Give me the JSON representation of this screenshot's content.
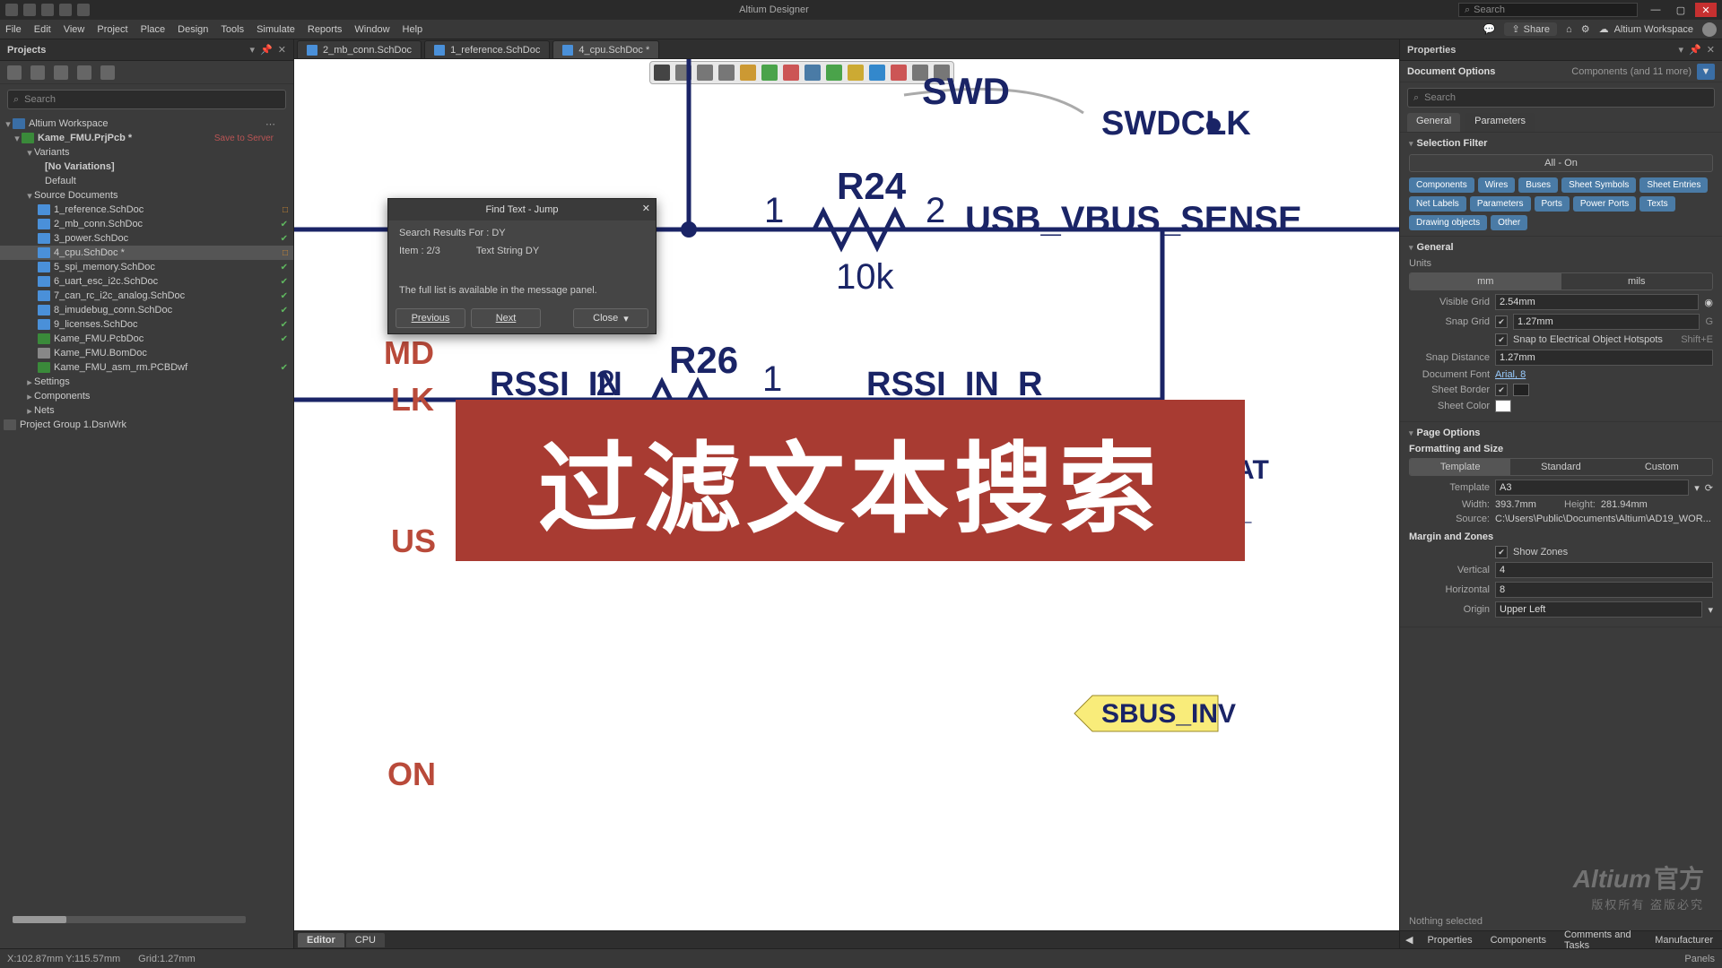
{
  "app_title": "Altium Designer",
  "global_search_placeholder": "Search",
  "menu": [
    "File",
    "Edit",
    "View",
    "Project",
    "Place",
    "Design",
    "Tools",
    "Simulate",
    "Reports",
    "Window",
    "Help"
  ],
  "share_label": "Share",
  "workspace_label": "Altium Workspace",
  "projects_panel_title": "Projects",
  "project_search_placeholder": "Search",
  "tree": {
    "ws": "Altium Workspace",
    "project": "Kame_FMU.PrjPcb *",
    "save_to_server": "Save to Server",
    "variants": "Variants",
    "no_var": "[No Variations]",
    "default": "Default",
    "src": "Source Documents",
    "docs": [
      {
        "n": "1_reference.SchDoc",
        "i": "sch",
        "mark": "mod"
      },
      {
        "n": "2_mb_conn.SchDoc",
        "i": "sch",
        "mark": "ok"
      },
      {
        "n": "3_power.SchDoc",
        "i": "sch",
        "mark": "ok"
      },
      {
        "n": "4_cpu.SchDoc *",
        "i": "sch",
        "mark": "mod",
        "sel": true
      },
      {
        "n": "5_spi_memory.SchDoc",
        "i": "sch",
        "mark": "ok"
      },
      {
        "n": "6_uart_esc_i2c.SchDoc",
        "i": "sch",
        "mark": "ok"
      },
      {
        "n": "7_can_rc_i2c_analog.SchDoc",
        "i": "sch",
        "mark": "ok"
      },
      {
        "n": "8_imudebug_conn.SchDoc",
        "i": "sch",
        "mark": "ok"
      },
      {
        "n": "9_licenses.SchDoc",
        "i": "sch",
        "mark": "ok"
      }
    ],
    "pcb": "Kame_FMU.PcbDoc",
    "bom": "Kame_FMU.BomDoc",
    "pcbdwf": "Kame_FMU_asm_rm.PCBDwf",
    "settings": "Settings",
    "components": "Components",
    "nets": "Nets",
    "group": "Project Group 1.DsnWrk"
  },
  "doc_tabs": [
    {
      "n": "2_mb_conn.SchDoc"
    },
    {
      "n": "1_reference.SchDoc"
    },
    {
      "n": "4_cpu.SchDoc *",
      "active": true
    }
  ],
  "canvas": {
    "swd": "SWD",
    "swdclk": "SWDCLK",
    "r24": "R24",
    "r24v": "10k",
    "pin1": "1",
    "pin2": "2",
    "usb": "USB_VBUS_SENSE",
    "r26": "R26",
    "rssi_in": "RSSI_IN",
    "rssi_in_r": "RSSI_IN_R",
    "heat": "MU_HEAT",
    "rc": "MU_RC_",
    "sbus": "SBUS_INV",
    "md": "MD",
    "lk": "LK",
    "us": "US",
    "on": "ON",
    "overlay": "过滤文本搜索"
  },
  "dialog": {
    "title": "Find Text - Jump",
    "results_for": "Search Results For : DY",
    "item": "Item : 2/3",
    "type": "Text String DY",
    "msg": "The full list is available in the message panel.",
    "prev": "Previous",
    "next": "Next",
    "close": "Close"
  },
  "editor_tabs": [
    "Editor",
    "CPU"
  ],
  "properties": {
    "title": "Properties",
    "doc_options": "Document Options",
    "more": "Components (and 11 more)",
    "search_placeholder": "Search",
    "tabs": [
      "General",
      "Parameters"
    ],
    "selection_filter": "Selection Filter",
    "all_on": "All - On",
    "chips": [
      "Components",
      "Wires",
      "Buses",
      "Sheet Symbols",
      "Sheet Entries",
      "Net Labels",
      "Parameters",
      "Ports",
      "Power Ports",
      "Texts",
      "Drawing objects",
      "Other"
    ],
    "general": "General",
    "units": "Units",
    "mm": "mm",
    "mils": "mils",
    "visible_grid": "Visible Grid",
    "visible_grid_v": "2.54mm",
    "snap_grid": "Snap Grid",
    "snap_grid_v": "1.27mm",
    "snap_g_key": "G",
    "snap_elec": "Snap to Electrical Object Hotspots",
    "snap_elec_key": "Shift+E",
    "snap_dist": "Snap Distance",
    "snap_dist_v": "1.27mm",
    "doc_font": "Document Font",
    "doc_font_v": "Arial, 8",
    "sheet_border": "Sheet Border",
    "sheet_color": "Sheet Color",
    "page_options": "Page Options",
    "fmt_size": "Formatting and Size",
    "template": "Template",
    "std": "Standard",
    "custom": "Custom",
    "template_lbl": "Template",
    "template_v": "A3",
    "width": "Width:",
    "width_v": "393.7mm",
    "height": "Height:",
    "height_v": "281.94mm",
    "source": "Source:",
    "source_v": "C:\\Users\\Public\\Documents\\Altium\\AD19_WOR...",
    "margin_zones": "Margin and Zones",
    "show_zones": "Show Zones",
    "vertical": "Vertical",
    "vertical_v": "4",
    "horizontal": "Horizontal",
    "horizontal_v": "8",
    "origin": "Origin",
    "origin_v": "Upper Left",
    "nothing": "Nothing selected",
    "bottom_tabs": [
      "Properties",
      "Components",
      "Comments and Tasks",
      "Manufacturer"
    ]
  },
  "watermark": {
    "brand": "Altium",
    "line1": "官方",
    "line2": "版权所有 盗版必究"
  },
  "status": {
    "coords": "X:102.87mm Y:115.57mm",
    "grid": "Grid:1.27mm",
    "panels": "Panels"
  }
}
